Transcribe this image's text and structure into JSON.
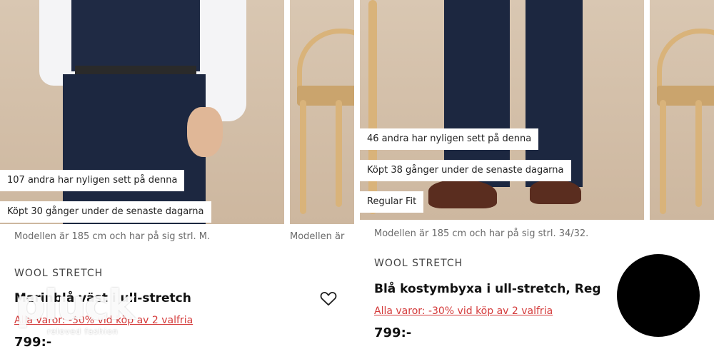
{
  "left_product": {
    "social_proof_views": "107 andra har nyligen sett på denna",
    "social_proof_bought": "Köpt 30 gånger under de senaste dagarna",
    "model_note": "Modellen är 185 cm och har på sig strl. M.",
    "next_model_note": "Modellen är",
    "brand_label": "WOOL STRETCH",
    "title": "Marinblå väst i ull-stretch",
    "promo": "Alla varor: -30% vid köp av 2 valfria",
    "price": "799:-",
    "favorite_icon": "heart-outline-icon"
  },
  "right_product": {
    "social_proof_views": "46 andra har nyligen sett på denna",
    "social_proof_bought": "Köpt 38 gånger under de senaste dagarna",
    "fit_tag": "Regular Fit",
    "model_note": "Modellen är 185 cm och har på sig strl. 34/32.",
    "brand_label": "WOOL STRETCH",
    "title": "Blå kostymbyxa i ull-stretch, Reg",
    "promo": "Alla varor: -30% vid köp av 2 valfria",
    "price": "799:-"
  },
  "watermark": {
    "main": "pluck",
    "sub": "reloved fashion"
  },
  "colors": {
    "promo_red": "#d43a3a",
    "backdrop": "#d6c3ae",
    "navy": "#1f2a44"
  }
}
